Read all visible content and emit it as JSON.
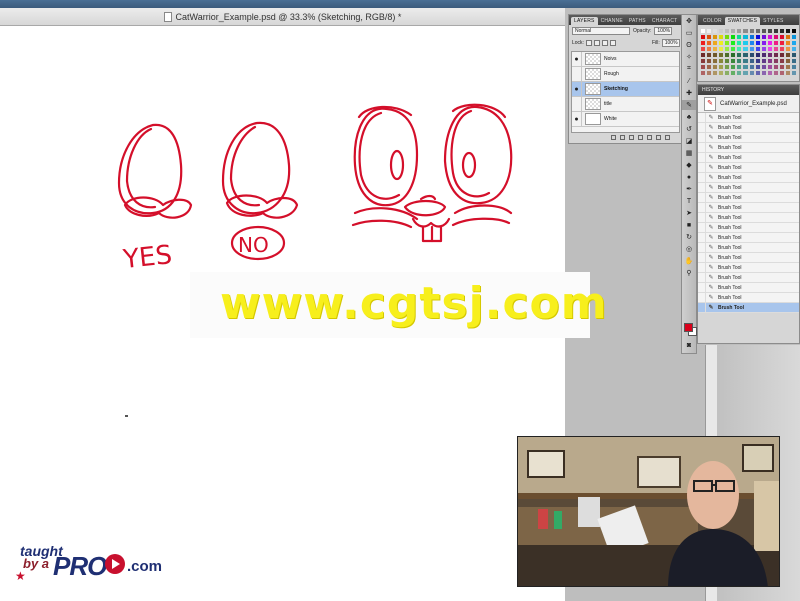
{
  "window": {
    "title": "CatWarrior_Example.psd @ 33.3% (Sketching, RGB/8) *"
  },
  "layers_panel": {
    "tabs": [
      "LAYERS",
      "CHANNE",
      "PATHS",
      "CHARACT"
    ],
    "blend_mode": "Normal",
    "opacity_label": "Opacity:",
    "opacity_value": "100%",
    "lock_label": "Lock:",
    "fill_label": "Fill:",
    "fill_value": "100%",
    "layers": [
      {
        "name": "Noivs",
        "visible": true,
        "selected": false
      },
      {
        "name": "Rough",
        "visible": false,
        "selected": false
      },
      {
        "name": "Sketching",
        "visible": true,
        "selected": true
      },
      {
        "name": "title",
        "visible": false,
        "selected": false
      },
      {
        "name": "White",
        "visible": true,
        "selected": false
      }
    ]
  },
  "swatches_panel": {
    "tabs": [
      "COLOR",
      "SWATCHES",
      "STYLES"
    ]
  },
  "history_panel": {
    "title": "HISTORY",
    "snapshot": "CatWarrior_Example.psd",
    "items": [
      "Brush Tool",
      "Brush Tool",
      "Brush Tool",
      "Brush Tool",
      "Brush Tool",
      "Brush Tool",
      "Brush Tool",
      "Brush Tool",
      "Brush Tool",
      "Brush Tool",
      "Brush Tool",
      "Brush Tool",
      "Brush Tool",
      "Brush Tool",
      "Brush Tool",
      "Brush Tool",
      "Brush Tool",
      "Brush Tool",
      "Brush Tool",
      "Brush Tool"
    ]
  },
  "sketch": {
    "label_yes": "YES",
    "label_no": "NO",
    "stroke_color": "#d40f2a"
  },
  "watermark": {
    "text": "www.cgtsj.com"
  },
  "logo": {
    "line1": "taught",
    "line2": "by a",
    "brand": "PRO",
    "suffix": ".com"
  },
  "colors": {
    "foreground": "#d9001b",
    "background": "#ffffff"
  }
}
